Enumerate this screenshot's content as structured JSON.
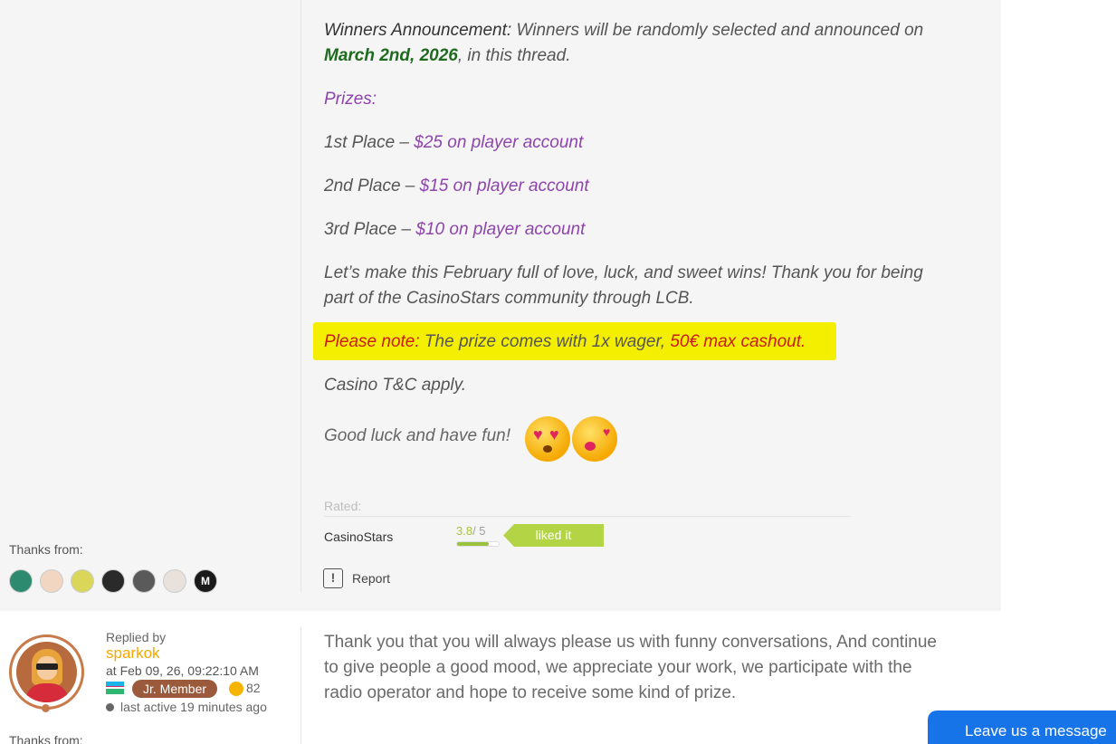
{
  "post": {
    "winners_label": "Winners Announcement:",
    "winners_text_a": " Winners will be randomly selected and announced on",
    "winners_date": "March 2nd, 2026",
    "winners_text_b": ", in this thread.",
    "prizes_label": "Prizes:",
    "prizes": [
      {
        "place": "1st Place – ",
        "amount": "$25 on player account"
      },
      {
        "place": "2nd Place – ",
        "amount": "$15 on player account"
      },
      {
        "place": "3rd Place – ",
        "amount": "$10 on player account"
      }
    ],
    "closing_line1": "Let’s make this February full of love, luck, and sweet wins! Thank you for being",
    "closing_line2": "part of the CasinoStars community through LCB.",
    "note_label": "Please note:",
    "note_text": " The prize comes with 1x wager, ",
    "note_cashout": "50€ max cashout.",
    "tc": "Casino T&C apply.",
    "good_luck": "Good luck and have fun!",
    "emojis": [
      "heart-eyes-emoji",
      "kissing-heart-emoji"
    ],
    "highlight_color": "#f4ef00"
  },
  "rating": {
    "label": "Rated:",
    "rater": "CasinoStars",
    "score": "3.8",
    "max": "/ 5",
    "fraction": 0.76,
    "action": "liked it"
  },
  "report_label": "Report",
  "thanks1": {
    "label": "Thanks from:",
    "avatars": [
      "avatar-1",
      "avatar-2",
      "avatar-3",
      "avatar-4",
      "avatar-5",
      "avatar-6",
      "avatar-7"
    ]
  },
  "reply": {
    "replied_by": "Replied by",
    "username": "sparkok",
    "date": "at Feb 09, 26, 09:22:10 AM",
    "rank": "Jr. Member",
    "coins": "82",
    "last_active": "last active 19 minutes ago",
    "text_line1": "Thank you that you will always please us with funny conversations, And continue",
    "text_line2": "to give people a good mood, we appreciate your work, we participate with the",
    "text_line3": "radio operator and hope to receive some kind of prize.",
    "thanks_label": "Thanks from:"
  },
  "chat_widget": {
    "label": "Leave us a message"
  },
  "colors": {
    "accent_green": "#b3d445",
    "username_orange": "#f5a800",
    "chat_blue": "#1774e8"
  }
}
